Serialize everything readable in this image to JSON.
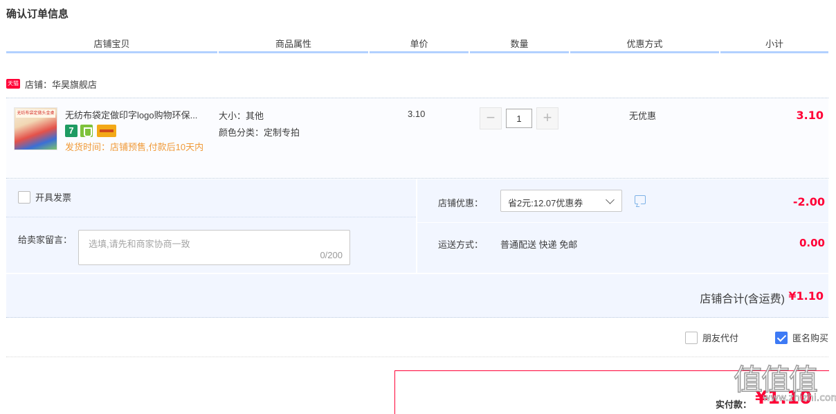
{
  "page": {
    "title": "确认订单信息"
  },
  "columns": [
    "店铺宝贝",
    "商品属性",
    "单价",
    "数量",
    "优惠方式",
    "小计"
  ],
  "shop": {
    "badge": "天猫",
    "label": "店铺：华昊旗舰店"
  },
  "item": {
    "thumb_text": "无纺布袋定做头金桌",
    "title": "无纺布袋定做印字logo购物环保...",
    "service_icons": [
      "seven-day-return-icon",
      "shield-guarantee-icon",
      "credit-card-icon"
    ],
    "service_seven": "7",
    "delivery": "发货时间：店铺预售,付款后10天内",
    "props": [
      "大小：其他",
      "颜色分类：定制专拍"
    ],
    "unit_price": "3.10",
    "quantity": "1",
    "qty_minus": "−",
    "qty_plus": "+",
    "discount": "无优惠",
    "subtotal": "3.10"
  },
  "invoice": {
    "label": "开具发票",
    "checked": false
  },
  "message": {
    "label": "给卖家留言：",
    "placeholder": "选填,请先和商家协商一致",
    "count": "0/200"
  },
  "coupon": {
    "label": "店铺优惠：",
    "selected": "省2元:12.07优惠券",
    "amount": "-2.00"
  },
  "shipping": {
    "label": "运送方式：",
    "value": "普通配送 快递 免邮",
    "amount": "0.00"
  },
  "shop_total": {
    "label": "店铺合计(含运费)",
    "amount": "¥1.10"
  },
  "options": {
    "friend_pay": {
      "label": "朋友代付",
      "checked": false
    },
    "anonymous": {
      "label": "匿名购买",
      "checked": true
    }
  },
  "payment": {
    "label": "实付款：",
    "amount": "¥1.10"
  },
  "watermark": {
    "glyphs": "值值值",
    "url": "www.zhizhi.com"
  },
  "colors": {
    "accent": "#ff0036",
    "header_rule": "#b2d1ff",
    "panel_bg": "#f2f6ff",
    "delivery": "#f09a38",
    "checkbox_checked": "#3d7af5"
  }
}
